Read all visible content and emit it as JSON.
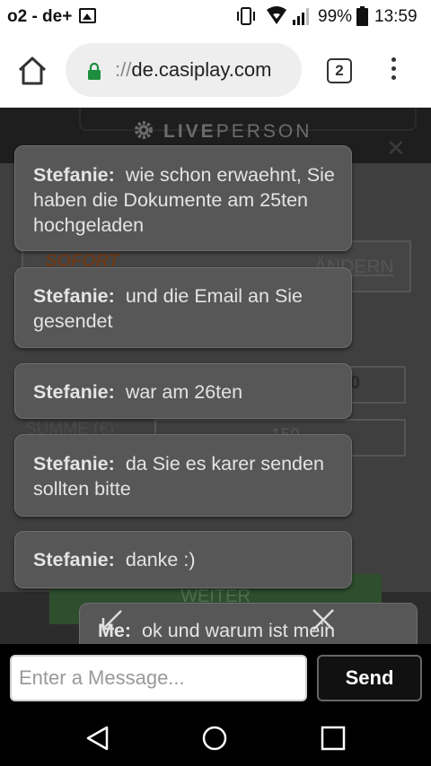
{
  "status_bar": {
    "carrier": "o2 - de+",
    "battery_percent": "99%",
    "time": "13:59"
  },
  "browser": {
    "url_scheme": "://",
    "url_host": "de.casiplay.com",
    "tab_count": "2"
  },
  "chat_widget": {
    "brand_bold": "LIVE",
    "brand_light": "PERSON",
    "messages": [
      {
        "sender": "Stefanie:",
        "text": "wie schon erwaehnt, Sie haben die Dokumente am 25ten hochgeladen"
      },
      {
        "sender": "Stefanie:",
        "text": "und die Email an Sie gesendet"
      },
      {
        "sender": "Stefanie:",
        "text": "war am 26ten"
      },
      {
        "sender": "Stefanie:",
        "text": "da Sie es karer senden sollten bitte"
      },
      {
        "sender": "Stefanie:",
        "text": "danke :)"
      }
    ],
    "draft_bubble": {
      "sender": "Me:",
      "text": "ok und warum ist mein"
    },
    "input_placeholder": "Enter a Message...",
    "send_label": "Send"
  },
  "background_page": {
    "payment_logo": "SOFORT",
    "change_link": "ÄNDERN",
    "field_value": "0",
    "sum_label": "SUMME (€):",
    "sum_value": "150",
    "continue_label": "WEITER"
  },
  "colors": {
    "chat_bubble": "#575757",
    "page_dim": "#3f3f3f",
    "lock_green": "#1e8e3e"
  }
}
